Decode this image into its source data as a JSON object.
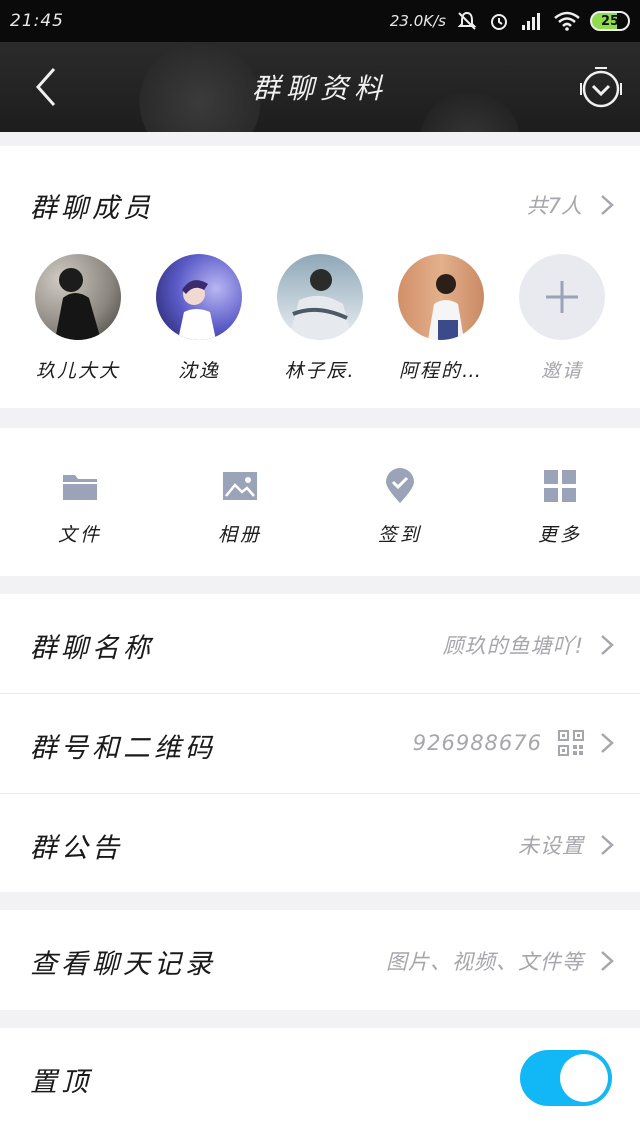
{
  "status_bar": {
    "time": "21:45",
    "net_speed": "23.0K/s",
    "battery": "25"
  },
  "header": {
    "title": "群聊资料"
  },
  "members": {
    "title": "群聊成员",
    "count_label": "共7人",
    "list": [
      {
        "name": "玖儿大大"
      },
      {
        "name": "沈逸"
      },
      {
        "name": "林子辰."
      },
      {
        "name": "阿程的…"
      }
    ],
    "invite_label": "邀请"
  },
  "tools": [
    {
      "label": "文件",
      "icon": "folder-icon"
    },
    {
      "label": "相册",
      "icon": "image-icon"
    },
    {
      "label": "签到",
      "icon": "checkin-icon"
    },
    {
      "label": "更多",
      "icon": "grid-icon"
    }
  ],
  "info": {
    "group_name_label": "群聊名称",
    "group_name_value": "顾玖的鱼塘吖!",
    "group_number_label": "群号和二维码",
    "group_number_value": "926988676",
    "announcement_label": "群公告",
    "announcement_value": "未设置"
  },
  "history": {
    "label": "查看聊天记录",
    "value": "图片、视频、文件等"
  },
  "pin": {
    "label": "置顶",
    "enabled": true
  },
  "colors": {
    "accent": "#12b7f5",
    "muted_text": "#a6a6ad",
    "icon_gray": "#9aa3b8"
  }
}
